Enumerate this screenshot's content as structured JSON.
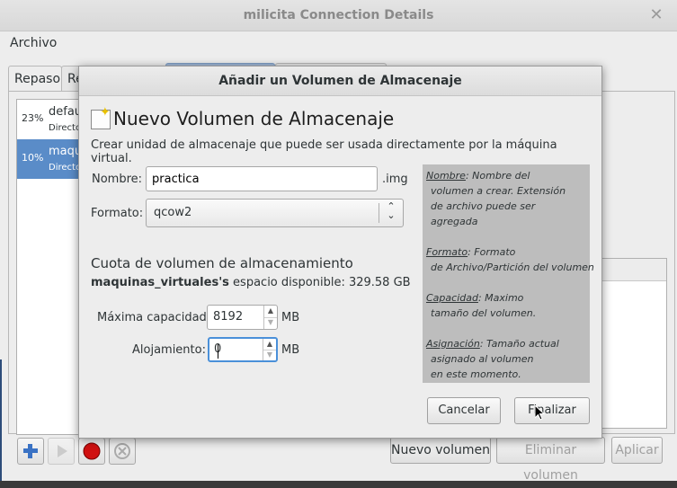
{
  "bg_window": {
    "title": "milicita Connection Details",
    "close": "✕",
    "menu": [
      "Archivo"
    ],
    "tabs": [
      "Repaso",
      "Re"
    ],
    "pools": [
      {
        "pct": "23%",
        "name": "default",
        "sub": "Directorio"
      },
      {
        "pct": "10%",
        "name": "maquinas",
        "sub": "Directorio"
      }
    ],
    "toolbar_icons": [
      "add-icon",
      "start-icon",
      "stop-icon",
      "delete-icon"
    ],
    "buttons": {
      "new_volume": "Nuevo volumen",
      "delete_volume": "Eliminar volumen",
      "apply": "Aplicar"
    }
  },
  "dialog": {
    "title": "Añadir un Volumen de Almacenaje",
    "heading": "Nuevo Volumen de Almacenaje",
    "description": "Crear unidad de almacenaje que puede ser usada directamente por la máquina virtual.",
    "name_label": "Nombre:",
    "name_value": "practica",
    "name_ext": ".img",
    "format_label": "Formato:",
    "format_value": "qcow2",
    "quota_title": "Cuota de volumen de almacenamiento",
    "pool_name": "maquinas_virtuales's",
    "pool_space": " espacio disponible: 329.58 GB",
    "max_label": "Máxima capacidad:",
    "max_value": "8192",
    "max_unit": "MB",
    "alloc_label": "Alojamiento:",
    "alloc_value": "0",
    "alloc_unit": "MB",
    "cancel": "Cancelar",
    "finish": "Finalizar",
    "help": {
      "nombre_key": "Nombre",
      "nombre_text": ": Nombre del",
      "nombre_l2": "volumen a crear. Extensión",
      "nombre_l3": "de archivo puede ser",
      "nombre_l4": "agregada",
      "formato_key": "Formato",
      "formato_text": ": Formato",
      "formato_l2": "de Archivo/Partición del volumen",
      "capacidad_key": "Capacidad",
      "capacidad_text": ": Maximo",
      "capacidad_l2": "tamaño del volumen.",
      "asignacion_key": "Asignación",
      "asignacion_text": ": Tamaño actual",
      "asignacion_l2": "asignado al volumen",
      "asignacion_l3": "en este momento."
    }
  }
}
